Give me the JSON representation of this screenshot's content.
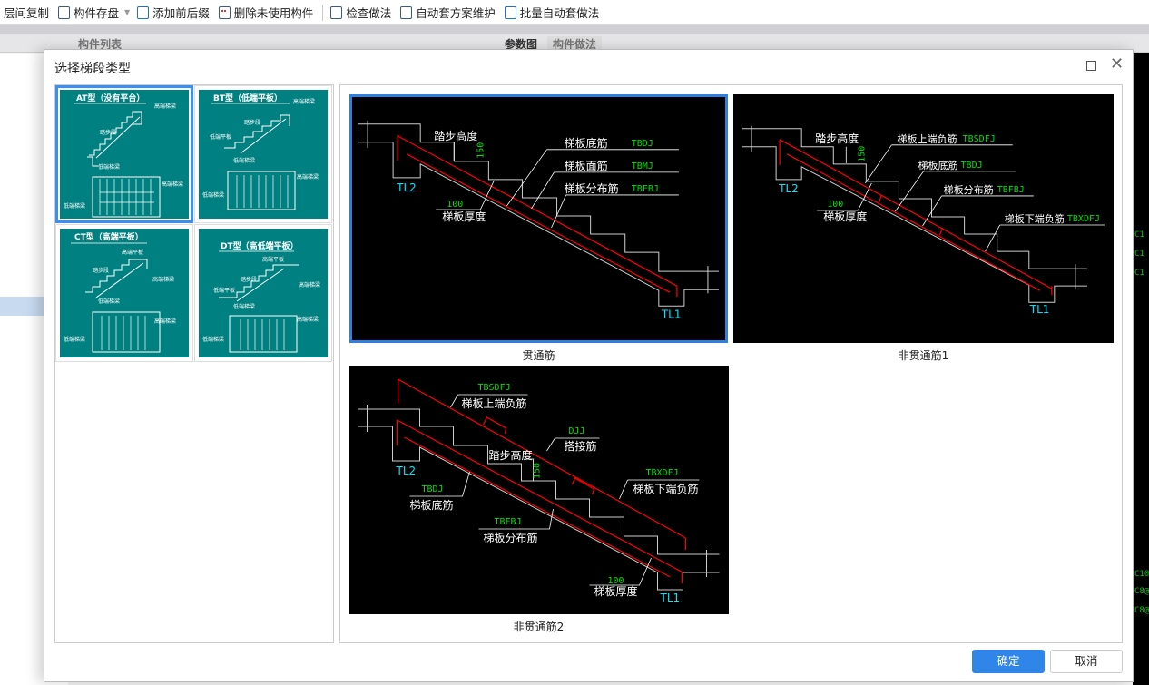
{
  "toolbar": {
    "items": [
      {
        "label": "层间复制",
        "icon": "copy-floor-icon"
      },
      {
        "label": "构件存盘",
        "icon": "save-component-icon"
      },
      {
        "label": "添加前后缀",
        "icon": "add-prefix-icon"
      },
      {
        "label": "删除未使用构件",
        "icon": "delete-unused-icon"
      },
      {
        "label": "检查做法",
        "icon": "check-method-icon"
      },
      {
        "label": "自动套方案维护",
        "icon": "auto-scheme-icon"
      },
      {
        "label": "批量自动套做法",
        "icon": "batch-auto-icon"
      }
    ]
  },
  "background": {
    "panel_title": "构件列表",
    "tabs": [
      "参数图",
      "构件做法"
    ],
    "cad_labels": [
      "C1",
      "C1",
      "C1",
      "C10",
      "C8@",
      "C8@"
    ]
  },
  "dialog": {
    "title": "选择梯段类型",
    "types": [
      {
        "title": "AT型（没有平台）",
        "labels": [
          "高端梯梁",
          "踏步段",
          "低端梯梁",
          "高端梯梁",
          "低端梯梁"
        ]
      },
      {
        "title": "BT型（低端平板）",
        "labels": [
          "高端梯梁",
          "踏步段",
          "低端平板",
          "低端梯梁",
          "高端梯梁",
          "低端梯梁"
        ]
      },
      {
        "title": "CT型（高端平板）",
        "labels": [
          "高端平板",
          "踏步段",
          "高端梯梁",
          "低端梯梁",
          "高端梯梁",
          "低端梯梁"
        ]
      },
      {
        "title": "DT型（高低端平板）",
        "labels": [
          "高端平板",
          "踏步段",
          "低端平板",
          "高端梯梁",
          "低端梯梁",
          "高端梯梁",
          "低端梯梁"
        ]
      }
    ],
    "selected_type": 0,
    "options": [
      {
        "caption": "贯通筋",
        "labels": {
          "step_height": "踏步高度",
          "h150": "150",
          "tl2": "TL2",
          "tl1": "TL1",
          "t100": "100",
          "thickness": "梯板厚度",
          "bottom": "梯板底筋",
          "bottom_code": "TBDJ",
          "top": "梯板面筋",
          "top_code": "TBMJ",
          "dist": "梯板分布筋",
          "dist_code": "TBFBJ"
        }
      },
      {
        "caption": "非贯通筋1",
        "labels": {
          "step_height": "踏步高度",
          "h150": "150",
          "tl2": "TL2",
          "tl1": "TL1",
          "t100": "100",
          "thickness": "梯板厚度",
          "upper": "梯板上端负筋",
          "upper_code": "TBSDFJ",
          "bottom": "梯板底筋",
          "bottom_code": "TBDJ",
          "dist": "梯板分布筋",
          "dist_code": "TBFBJ",
          "lower": "梯板下端负筋",
          "lower_code": "TBXDFJ"
        }
      },
      {
        "caption": "非贯通筋2",
        "labels": {
          "step_height": "踏步高度",
          "h150": "150",
          "tl2": "TL2",
          "tl1": "TL1",
          "t100": "100",
          "thickness": "梯板厚度",
          "upper": "梯板上端负筋",
          "upper_code": "TBSDFJ",
          "lap": "搭接筋",
          "lap_code": "DJJ",
          "lower": "梯板下端负筋",
          "lower_code": "TBXDFJ",
          "bottom": "梯板底筋",
          "bottom_code": "TBDJ",
          "dist": "梯板分布筋",
          "dist_code": "TBFBJ"
        }
      }
    ],
    "selected_option": 0,
    "ok_label": "确定",
    "cancel_label": "取消"
  },
  "colors": {
    "accent": "#2f86e8",
    "thumb_bg": "#008080",
    "rebar": "#ff0000",
    "code_text": "#00e000",
    "beam_text": "#00e5ff"
  }
}
